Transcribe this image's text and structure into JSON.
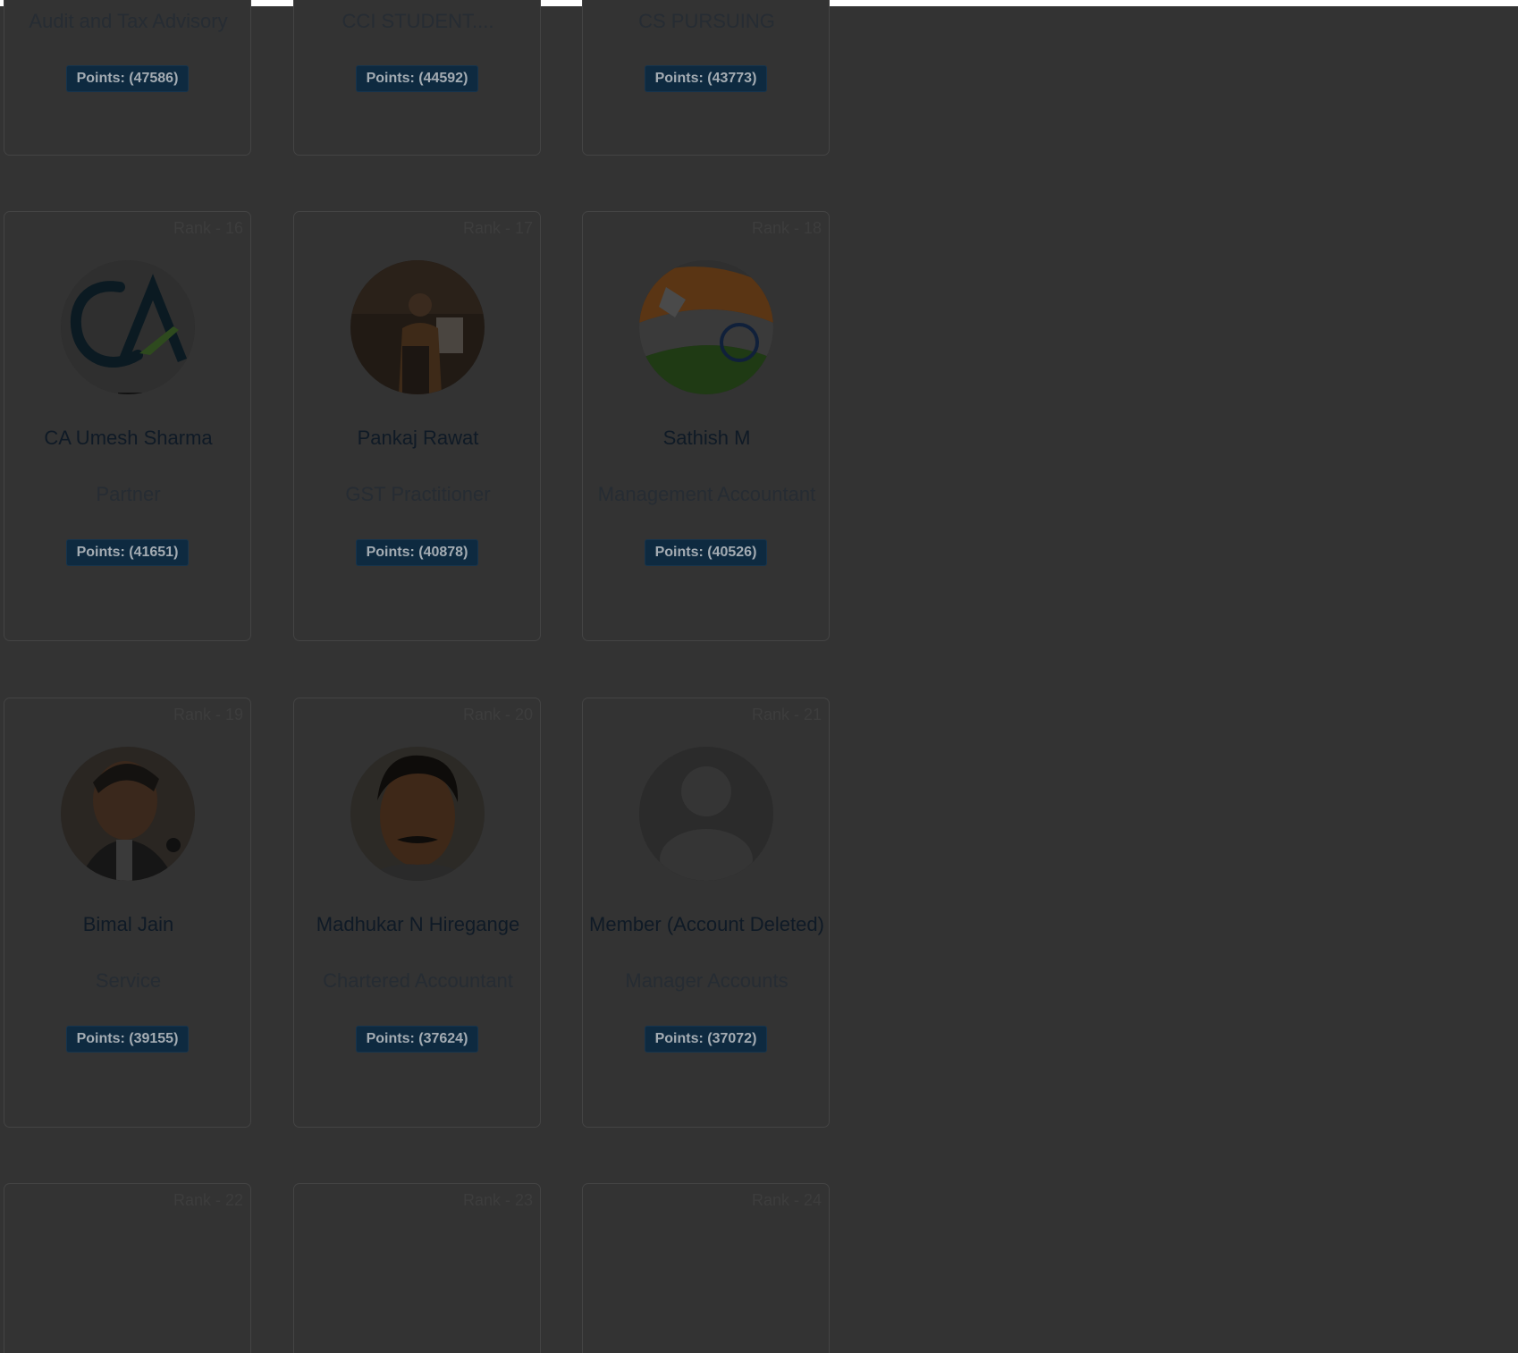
{
  "colors": {
    "backdrop": "#333333",
    "points_badge": "#0e2a40",
    "name_text": "#0f1a26"
  },
  "row0": [
    {
      "title": "Audit and Tax Advisory",
      "points": "Points: (47586)"
    },
    {
      "title": "CCI STUDENT....",
      "points": "Points: (44592)"
    },
    {
      "title": "CS PURSUING",
      "points": "Points: (43773)"
    }
  ],
  "row1": [
    {
      "rank": "Rank - 16",
      "name": "CA Umesh Sharma",
      "title": "Partner",
      "points": "Points: (41651)",
      "avatar": "ca-logo-avatar"
    },
    {
      "rank": "Rank - 17",
      "name": "Pankaj Rawat",
      "title": "GST Practitioner",
      "points": "Points: (40878)",
      "avatar": "speaker-photo-avatar"
    },
    {
      "rank": "Rank - 18",
      "name": "Sathish M",
      "title": "Management Accountant",
      "points": "Points: (40526)",
      "avatar": "india-flag-avatar"
    }
  ],
  "row2": [
    {
      "rank": "Rank - 19",
      "name": "Bimal Jain",
      "title": "Service",
      "points": "Points: (39155)",
      "avatar": "portrait-photo-avatar"
    },
    {
      "rank": "Rank - 20",
      "name": "Madhukar N Hiregange",
      "title": "Chartered Accountant",
      "points": "Points: (37624)",
      "avatar": "portrait-photo-avatar"
    },
    {
      "rank": "Rank - 21",
      "name": "Member (Account Deleted)",
      "title": "Manager Accounts",
      "points": "Points: (37072)",
      "avatar": "default-user-avatar"
    }
  ],
  "row3": [
    {
      "rank": "Rank - 22"
    },
    {
      "rank": "Rank - 23"
    },
    {
      "rank": "Rank - 24"
    }
  ]
}
